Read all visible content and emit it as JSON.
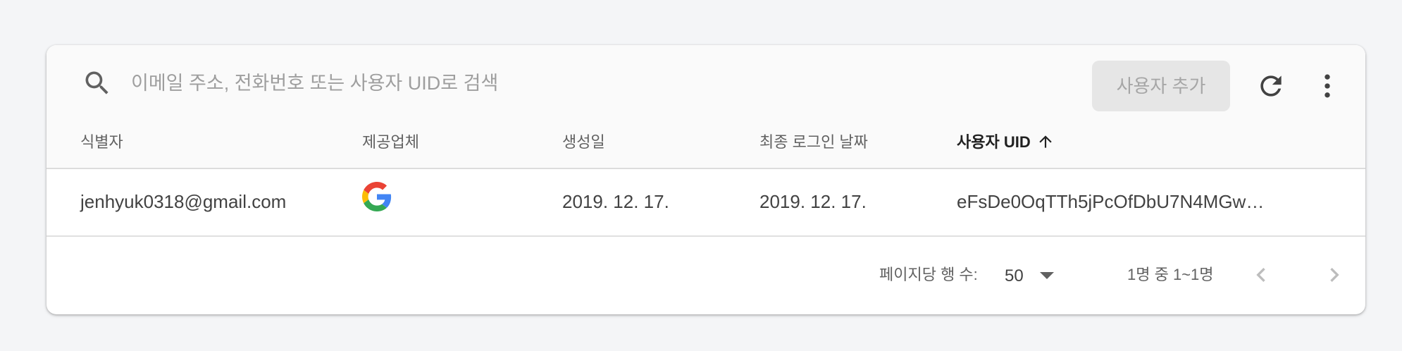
{
  "search": {
    "placeholder": "이메일 주소, 전화번호 또는 사용자 UID로 검색",
    "icon": "search-icon"
  },
  "toolbar": {
    "add_user_label": "사용자 추가",
    "refresh_icon": "refresh-icon",
    "more_icon": "more-vert-icon"
  },
  "table": {
    "columns": [
      "식별자",
      "제공업체",
      "생성일",
      "최종 로그인 날짜",
      "사용자 UID"
    ],
    "sort": {
      "column": "사용자 UID",
      "direction": "ascending",
      "icon": "arrow-up-icon"
    },
    "rows": [
      {
        "identifier": "jenhyuk0318@gmail.com",
        "provider": "google-icon",
        "created": "2019. 12. 17.",
        "last_sign_in": "2019. 12. 17.",
        "uid": "eFsDe0OqTTh5jPcOfDbU7N4MGw…"
      }
    ]
  },
  "pagination": {
    "rows_per_page_label": "페이지당 행 수:",
    "rows_per_page_value": "50",
    "range_label": "1명 중 1~1명",
    "prev_icon": "chevron-left-icon",
    "next_icon": "chevron-right-icon"
  },
  "colors": {
    "background": "#f4f5f7",
    "header_bg": "#fafafa",
    "disabled_button_bg": "#e6e6e6",
    "google_blue": "#4285F4",
    "google_red": "#EA4335",
    "google_yellow": "#FBBC05",
    "google_green": "#34A853"
  }
}
